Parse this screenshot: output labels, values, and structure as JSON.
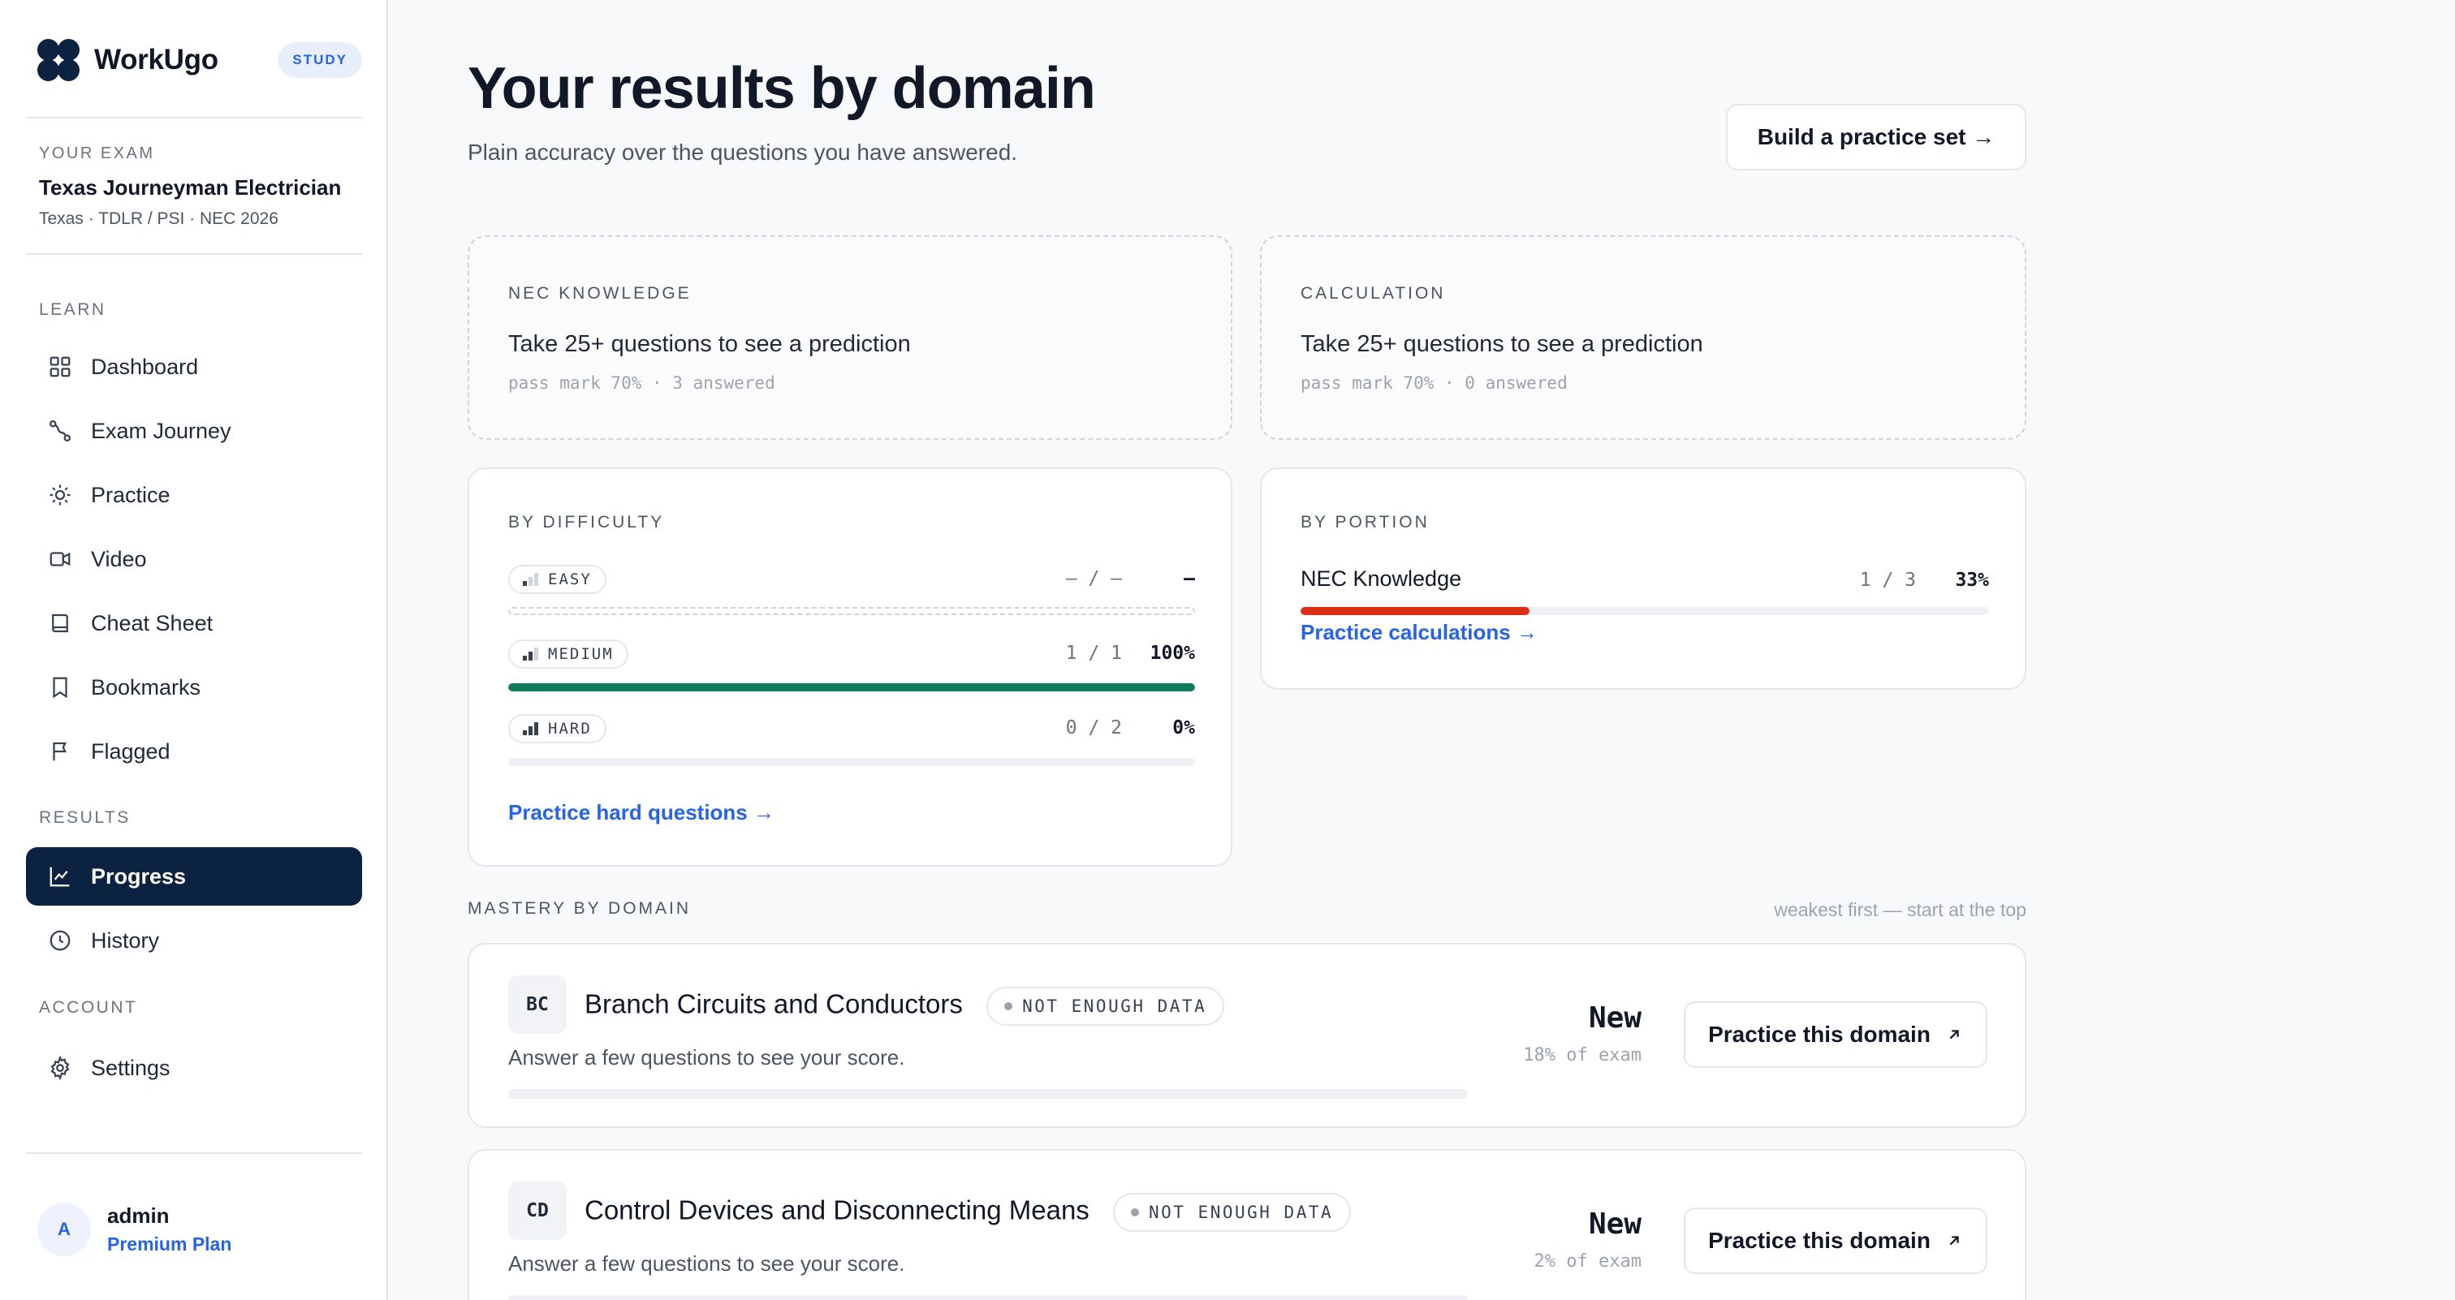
{
  "brand": {
    "name": "WorkUgo",
    "badge": "STUDY"
  },
  "exam": {
    "caption": "YOUR EXAM",
    "name": "Texas Journeyman Electrician",
    "meta": "Texas · TDLR / PSI · NEC 2026"
  },
  "nav": {
    "learn_caption": "LEARN",
    "learn": [
      {
        "label": "Dashboard",
        "icon": "grid-icon"
      },
      {
        "label": "Exam Journey",
        "icon": "route-icon"
      },
      {
        "label": "Practice",
        "icon": "sun-icon"
      },
      {
        "label": "Video",
        "icon": "video-icon"
      },
      {
        "label": "Cheat Sheet",
        "icon": "book-icon"
      },
      {
        "label": "Bookmarks",
        "icon": "bookmark-icon"
      },
      {
        "label": "Flagged",
        "icon": "flag-icon"
      }
    ],
    "results_caption": "RESULTS",
    "results": [
      {
        "label": "Progress",
        "icon": "chart-icon",
        "active": true
      },
      {
        "label": "History",
        "icon": "clock-icon"
      }
    ],
    "account_caption": "ACCOUNT",
    "account": [
      {
        "label": "Settings",
        "icon": "gear-icon"
      }
    ]
  },
  "user": {
    "initial": "A",
    "name": "admin",
    "plan": "Premium Plan"
  },
  "header": {
    "title": "Your results by domain",
    "subtitle": "Plain accuracy over the questions you have answered.",
    "build_button": "Build a practice set →"
  },
  "prediction_cards": [
    {
      "caption": "NEC KNOWLEDGE",
      "text": "Take 25+ questions to see a prediction",
      "meta": "pass mark 70% · 3 answered"
    },
    {
      "caption": "CALCULATION",
      "text": "Take 25+ questions to see a prediction",
      "meta": "pass mark 70% · 0 answered"
    }
  ],
  "difficulty": {
    "caption": "BY DIFFICULTY",
    "rows": [
      {
        "label": "EASY",
        "count": "– / –",
        "pct": "–",
        "fraction": 0,
        "color": "#d1d5db"
      },
      {
        "label": "MEDIUM",
        "count": "1 / 1",
        "pct": "100%",
        "fraction": 1.0,
        "color": "#0f7a5a"
      },
      {
        "label": "HARD",
        "count": "0 / 2",
        "pct": "0%",
        "fraction": 0,
        "color": "#d1d5db"
      }
    ],
    "link": "Practice hard questions →"
  },
  "portion": {
    "caption": "BY PORTION",
    "rows": [
      {
        "label": "NEC Knowledge",
        "count": "1 / 3",
        "pct": "33%",
        "fraction": 0.333,
        "color": "#dc2f17"
      }
    ],
    "link": "Practice calculations →"
  },
  "mastery": {
    "caption": "MASTERY BY DOMAIN",
    "hint": "weakest first — start at the top",
    "domains": [
      {
        "abbr": "BC",
        "name": "Branch Circuits and Conductors",
        "badge": "NOT ENOUGH DATA",
        "desc": "Answer a few questions to see your score.",
        "score": "New",
        "share": "18% of exam",
        "button": "Practice this domain"
      },
      {
        "abbr": "CD",
        "name": "Control Devices and Disconnecting Means",
        "badge": "NOT ENOUGH DATA",
        "desc": "Answer a few questions to see your score.",
        "score": "New",
        "share": "2% of exam",
        "button": "Practice this domain"
      }
    ]
  }
}
